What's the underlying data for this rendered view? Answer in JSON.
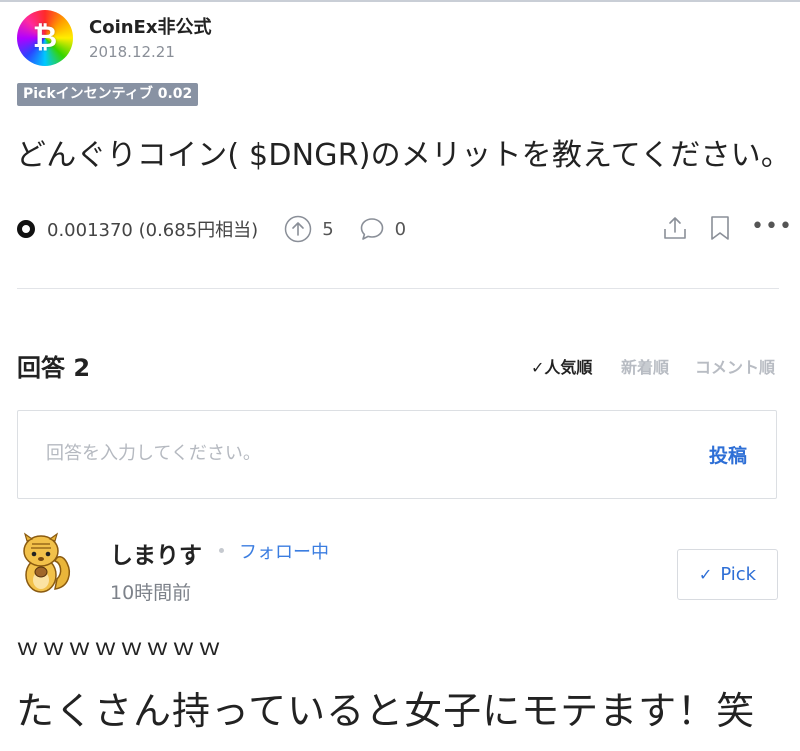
{
  "post": {
    "avatar_symbol": "₿",
    "author": "CoinEx非公式",
    "date": "2018.12.21",
    "badge": "Pickインセンティブ 0.02",
    "question": "どんぐりコイン( $DNGR)のメリットを教えてください。",
    "reward": "0.001370 (0.685円相当)",
    "upvotes": "5",
    "comments": "0",
    "more": "•••"
  },
  "answers": {
    "title": "回答 2",
    "sort_options": [
      "✓人気順",
      "新着順",
      "コメント順"
    ],
    "input_placeholder": "回答を入力してください。",
    "post_button": "投稿"
  },
  "answer": {
    "user": "しまりす",
    "follow_status": "フォロー中",
    "time": "10時間前",
    "pick_label": "Pick",
    "pick_check": "✓",
    "line1": "ｗｗｗｗｗｗｗｗ",
    "line2": "たくさん持っていると女子にモテます！笑"
  },
  "colors": {
    "accent": "#2e6fd6",
    "badge_bg": "#8892a3",
    "follow": "#3b7de0"
  }
}
